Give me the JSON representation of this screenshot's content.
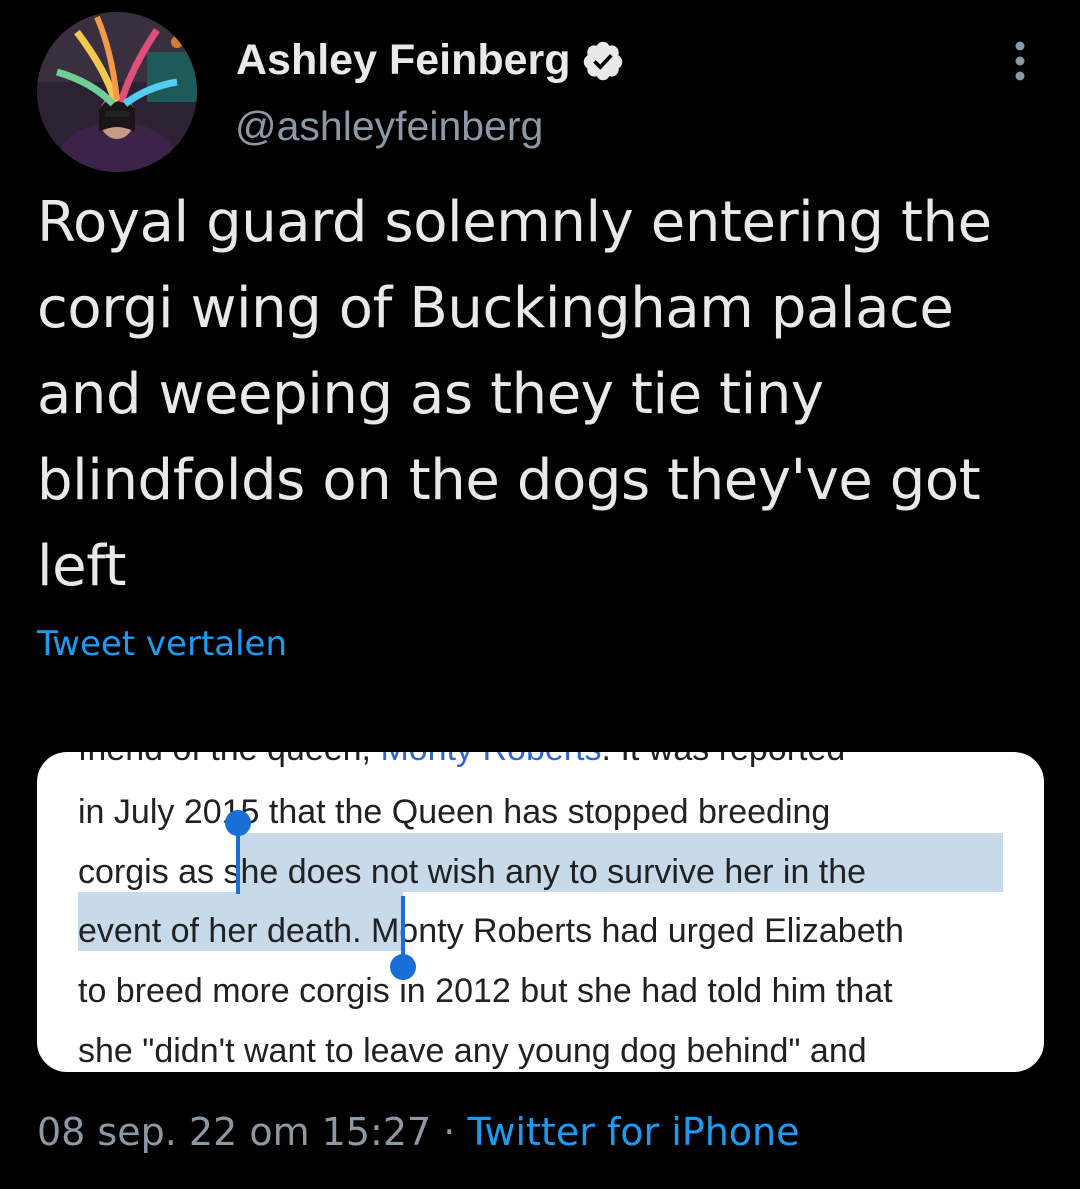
{
  "author": {
    "name": "Ashley Feinberg",
    "handle": "@ashleyfeinberg",
    "verified": true
  },
  "tweet": {
    "text": "Royal guard solemnly entering the corgi wing of Buckingham palace and weeping as they tie tiny blindfolds on the dogs they've got left",
    "translate_label": "Tweet vertalen"
  },
  "media": {
    "lines": [
      {
        "pre": "friend of the queen, ",
        "link": "Monty Roberts",
        "post": ".     It was reported"
      },
      {
        "text": "in July 2015 that the Queen has stopped breeding"
      },
      {
        "text": "corgis as she does not wish any to survive her in the"
      },
      {
        "text": "event of her death. Monty Roberts had urged Elizabeth"
      },
      {
        "text": "to breed more corgis in 2012 but she had told him that"
      },
      {
        "text": "she \"didn't want to leave any young dog behind\" and"
      }
    ],
    "selection_color": "#c8daea",
    "handle_color": "#1a6ed8"
  },
  "footer": {
    "timestamp": "08 sep. 22 om 15:27",
    "separator": "·",
    "client": "Twitter for iPhone"
  },
  "colors": {
    "background": "#000000",
    "text_primary": "#e7e9ea",
    "text_secondary": "#8b98a5",
    "accent": "#1d9bf0"
  },
  "icons": {
    "verified": "verified-badge-icon",
    "more": "more-vertical-icon"
  }
}
